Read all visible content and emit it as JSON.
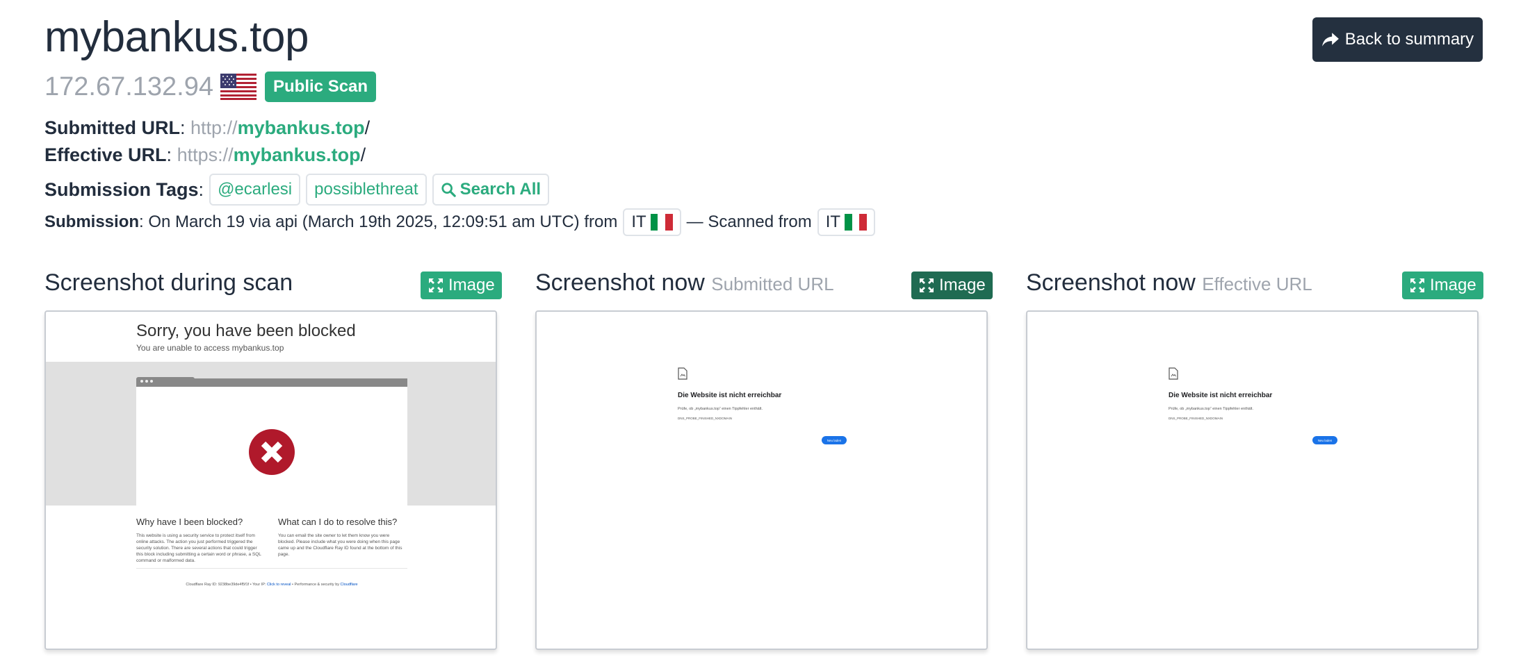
{
  "header": {
    "title": "mybankus.top",
    "ip": "172.67.132.94",
    "public_badge": "Public Scan",
    "back_button": "Back to summary"
  },
  "submitted": {
    "label": "Submitted URL",
    "scheme": "http://",
    "domain": "mybankus.top",
    "path": "/"
  },
  "effective": {
    "label": "Effective URL",
    "scheme": "https://",
    "domain": "mybankus.top",
    "path": "/"
  },
  "tags": {
    "label": "Submission Tags",
    "items": [
      "@ecarlesi",
      "possiblethreat"
    ],
    "search_all": "Search All"
  },
  "submission": {
    "label": "Submission",
    "text": ": On March 19 via api (March 19th 2025, 12:09:51 am UTC) from",
    "from_country": "IT",
    "scanned_text": "— Scanned from",
    "scanned_country": "IT"
  },
  "sections": [
    {
      "title": "Screenshot during scan",
      "sub": "",
      "button": "Image"
    },
    {
      "title": "Screenshot now",
      "sub": "Submitted URL",
      "button": "Image"
    },
    {
      "title": "Screenshot now",
      "sub": "Effective URL",
      "button": "Image"
    }
  ],
  "blocked_page": {
    "title": "Sorry, you have been blocked",
    "subtitle": "You are unable to access mybankus.top",
    "why_heading": "Why have I been blocked?",
    "why_text": "This website is using a security service to protect itself from online attacks. The action you just performed triggered the security solution. There are several actions that could trigger this block including submitting a certain word or phrase, a SQL command or malformed data.",
    "what_heading": "What can I do to resolve this?",
    "what_text": "You can email the site owner to let them know you were blocked. Please include what you were doing when this page came up and the Cloudflare Ray ID found at the bottom of this page.",
    "footer_ray": "Cloudflare Ray ID: 9238be39de4f5f1f",
    "footer_ip": "Your IP:",
    "footer_ip_link": "Click to reveal",
    "footer_perf": "Performance & security by",
    "footer_cf": "Cloudflare"
  },
  "error_page": {
    "heading": "Die Website ist nicht erreichbar",
    "text": "Prüfe, ob „mybankus.top“ einen Tippfehler enthält.",
    "code": "DNS_PROBE_FINISHED_NXDOMAIN",
    "button": "Neu laden"
  },
  "colors": {
    "accent_green": "#2bab7e",
    "dark_green": "#1f6b52",
    "navy": "#24303f",
    "muted": "#9ea4ad"
  }
}
